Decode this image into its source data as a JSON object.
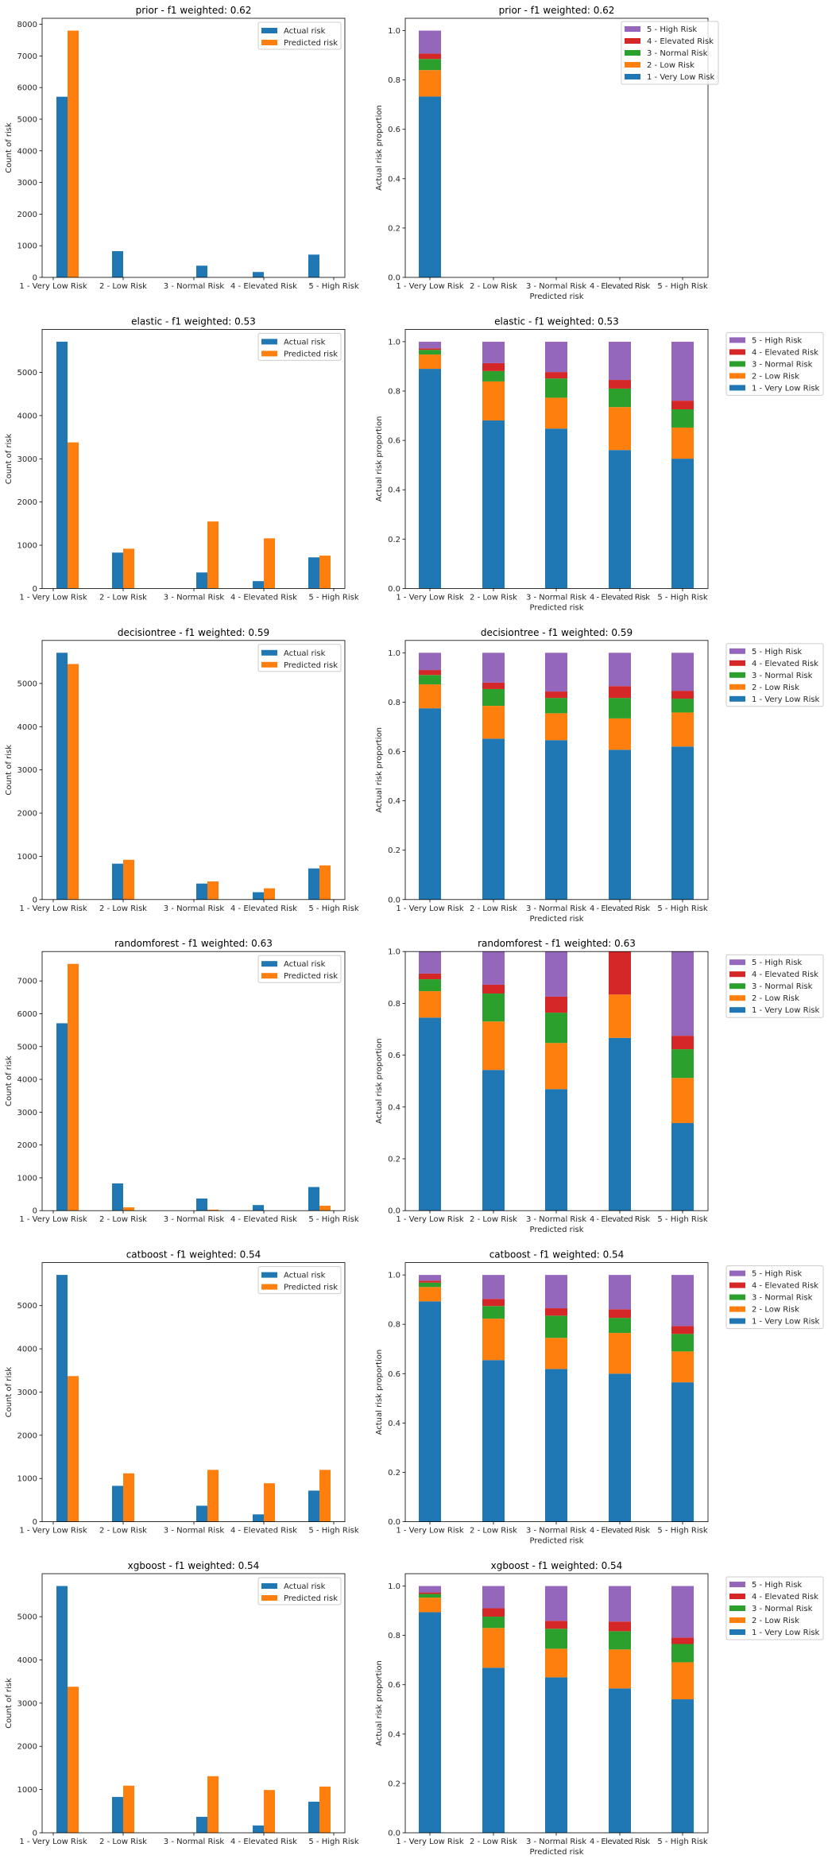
{
  "figure": {
    "categories": [
      "1 - Very Low Risk",
      "2 - Low Risk",
      "3 - Normal Risk",
      "4 - Elevated Risk",
      "5 - High Risk"
    ],
    "colors": {
      "actual": "#1f77b4",
      "predicted": "#ff7f0e",
      "risk": [
        "#1f77b4",
        "#ff7f0e",
        "#2ca02c",
        "#d62728",
        "#9467bd"
      ]
    },
    "count_chart_legend": [
      "Actual risk",
      "Predicted risk"
    ],
    "count_chart_ylabel": "Count of risk",
    "proportion_chart_ylabel": "Actual risk proportion",
    "proportion_chart_xlabel": "Predicted risk",
    "proportion_legend": [
      "5 - High Risk",
      "4 - Elevated Risk",
      "3 - Normal Risk",
      "2 - Low Risk",
      "1 - Very Low Risk"
    ]
  },
  "chart_data": [
    {
      "type": "bar",
      "model": "prior",
      "title": "prior - f1 weighted: 0.62",
      "categories": [
        "1 - Very Low Risk",
        "2 - Low Risk",
        "3 - Normal Risk",
        "4 - Elevated Risk",
        "5 - High Risk"
      ],
      "xlabel": "",
      "ylabel": "Count of risk",
      "ylim": [
        0,
        8190
      ],
      "yticks": [
        0,
        1000,
        2000,
        3000,
        4000,
        5000,
        6000,
        7000,
        8000
      ],
      "legend": "top-right",
      "series": [
        {
          "name": "Actual risk",
          "values": [
            5710,
            830,
            370,
            170,
            720
          ]
        },
        {
          "name": "Predicted risk",
          "values": [
            7800,
            0,
            0,
            0,
            0
          ]
        }
      ]
    },
    {
      "type": "bar",
      "stacked": true,
      "model": "prior",
      "title": "prior - f1 weighted: 0.62",
      "categories": [
        "1 - Very Low Risk",
        "2 - Low Risk",
        "3 - Normal Risk",
        "4 - Elevated Risk",
        "5 - High Risk"
      ],
      "xlabel": "Predicted risk",
      "ylabel": "Actual risk proportion",
      "ylim": [
        0,
        1.05
      ],
      "yticks": [
        0.0,
        0.2,
        0.4,
        0.6,
        0.8,
        1.0
      ],
      "legend": "top-right",
      "series": [
        {
          "name": "1 - Very Low Risk",
          "values": [
            0.733,
            0,
            0,
            0,
            0
          ]
        },
        {
          "name": "2 - Low Risk",
          "values": [
            0.107,
            0,
            0,
            0,
            0
          ]
        },
        {
          "name": "3 - Normal Risk",
          "values": [
            0.045,
            0,
            0,
            0,
            0
          ]
        },
        {
          "name": "4 - Elevated Risk",
          "values": [
            0.022,
            0,
            0,
            0,
            0
          ]
        },
        {
          "name": "5 - High Risk",
          "values": [
            0.093,
            0,
            0,
            0,
            0
          ]
        }
      ]
    },
    {
      "type": "bar",
      "model": "elastic",
      "title": "elastic - f1 weighted: 0.53",
      "categories": [
        "1 - Very Low Risk",
        "2 - Low Risk",
        "3 - Normal Risk",
        "4 - Elevated Risk",
        "5 - High Risk"
      ],
      "xlabel": "",
      "ylabel": "Count of risk",
      "ylim": [
        0,
        5995
      ],
      "yticks": [
        0,
        1000,
        2000,
        3000,
        4000,
        5000
      ],
      "legend": "top-right",
      "series": [
        {
          "name": "Actual risk",
          "values": [
            5710,
            830,
            370,
            170,
            720
          ]
        },
        {
          "name": "Predicted risk",
          "values": [
            3380,
            920,
            1550,
            1160,
            760
          ]
        }
      ]
    },
    {
      "type": "bar",
      "stacked": true,
      "model": "elastic",
      "title": "elastic - f1 weighted: 0.53",
      "categories": [
        "1 - Very Low Risk",
        "2 - Low Risk",
        "3 - Normal Risk",
        "4 - Elevated Risk",
        "5 - High Risk"
      ],
      "xlabel": "Predicted risk",
      "ylabel": "Actual risk proportion",
      "ylim": [
        0,
        1.05
      ],
      "yticks": [
        0.0,
        0.2,
        0.4,
        0.6,
        0.8,
        1.0
      ],
      "legend": "outside-right",
      "series": [
        {
          "name": "1 - Very Low Risk",
          "values": [
            0.89,
            0.681,
            0.648,
            0.561,
            0.526
          ]
        },
        {
          "name": "2 - Low Risk",
          "values": [
            0.058,
            0.158,
            0.125,
            0.174,
            0.126
          ]
        },
        {
          "name": "3 - Normal Risk",
          "values": [
            0.019,
            0.042,
            0.078,
            0.075,
            0.074
          ]
        },
        {
          "name": "4 - Elevated Risk",
          "values": [
            0.006,
            0.032,
            0.026,
            0.035,
            0.035
          ]
        },
        {
          "name": "5 - High Risk",
          "values": [
            0.027,
            0.087,
            0.123,
            0.155,
            0.239
          ]
        }
      ]
    },
    {
      "type": "bar",
      "model": "decisiontree",
      "title": "decisiontree - f1 weighted: 0.59",
      "categories": [
        "1 - Very Low Risk",
        "2 - Low Risk",
        "3 - Normal Risk",
        "4 - Elevated Risk",
        "5 - High Risk"
      ],
      "xlabel": "",
      "ylabel": "Count of risk",
      "ylim": [
        0,
        5995
      ],
      "yticks": [
        0,
        1000,
        2000,
        3000,
        4000,
        5000
      ],
      "legend": "top-right",
      "series": [
        {
          "name": "Actual risk",
          "values": [
            5710,
            830,
            370,
            170,
            720
          ]
        },
        {
          "name": "Predicted risk",
          "values": [
            5450,
            920,
            420,
            260,
            790
          ]
        }
      ]
    },
    {
      "type": "bar",
      "stacked": true,
      "model": "decisiontree",
      "title": "decisiontree - f1 weighted: 0.59",
      "categories": [
        "1 - Very Low Risk",
        "2 - Low Risk",
        "3 - Normal Risk",
        "4 - Elevated Risk",
        "5 - High Risk"
      ],
      "xlabel": "Predicted risk",
      "ylabel": "Actual risk proportion",
      "ylim": [
        0,
        1.05
      ],
      "yticks": [
        0.0,
        0.2,
        0.4,
        0.6,
        0.8,
        1.0
      ],
      "legend": "outside-right",
      "series": [
        {
          "name": "1 - Very Low Risk",
          "values": [
            0.775,
            0.652,
            0.646,
            0.607,
            0.62
          ]
        },
        {
          "name": "2 - Low Risk",
          "values": [
            0.097,
            0.133,
            0.109,
            0.127,
            0.138
          ]
        },
        {
          "name": "3 - Normal Risk",
          "values": [
            0.038,
            0.068,
            0.062,
            0.083,
            0.056
          ]
        },
        {
          "name": "4 - Elevated Risk",
          "values": [
            0.02,
            0.026,
            0.026,
            0.048,
            0.032
          ]
        },
        {
          "name": "5 - High Risk",
          "values": [
            0.07,
            0.121,
            0.157,
            0.135,
            0.154
          ]
        }
      ]
    },
    {
      "type": "bar",
      "model": "randomforest",
      "title": "randomforest - f1 weighted: 0.63",
      "categories": [
        "1 - Very Low Risk",
        "2 - Low Risk",
        "3 - Normal Risk",
        "4 - Elevated Risk",
        "5 - High Risk"
      ],
      "xlabel": "",
      "ylabel": "Count of risk",
      "ylim": [
        0,
        7896
      ],
      "yticks": [
        0,
        1000,
        2000,
        3000,
        4000,
        5000,
        6000,
        7000
      ],
      "legend": "top-right",
      "series": [
        {
          "name": "Actual risk",
          "values": [
            5710,
            830,
            370,
            170,
            720
          ]
        },
        {
          "name": "Predicted risk",
          "values": [
            7520,
            100,
            30,
            3,
            150
          ]
        }
      ]
    },
    {
      "type": "bar",
      "stacked": true,
      "model": "randomforest",
      "title": "randomforest - f1 weighted: 0.63",
      "categories": [
        "1 - Very Low Risk",
        "2 - Low Risk",
        "3 - Normal Risk",
        "4 - Elevated Risk",
        "5 - High Risk"
      ],
      "xlabel": "Predicted risk",
      "ylabel": "Actual risk proportion",
      "ylim": [
        0,
        1.0
      ],
      "yticks": [
        0.0,
        0.2,
        0.4,
        0.6,
        0.8,
        1.0
      ],
      "legend": "outside-right",
      "series": [
        {
          "name": "1 - Very Low Risk",
          "values": [
            0.745,
            0.543,
            0.469,
            0.667,
            0.338
          ]
        },
        {
          "name": "2 - Low Risk",
          "values": [
            0.102,
            0.187,
            0.178,
            0.167,
            0.174
          ]
        },
        {
          "name": "3 - Normal Risk",
          "values": [
            0.046,
            0.108,
            0.117,
            0.0,
            0.111
          ]
        },
        {
          "name": "4 - Elevated Risk",
          "values": [
            0.022,
            0.034,
            0.062,
            0.166,
            0.052
          ]
        },
        {
          "name": "5 - High Risk",
          "values": [
            0.085,
            0.128,
            0.174,
            0.0,
            0.325
          ]
        }
      ]
    },
    {
      "type": "bar",
      "model": "catboost",
      "title": "catboost - f1 weighted: 0.54",
      "categories": [
        "1 - Very Low Risk",
        "2 - Low Risk",
        "3 - Normal Risk",
        "4 - Elevated Risk",
        "5 - High Risk"
      ],
      "xlabel": "",
      "ylabel": "Count of risk",
      "ylim": [
        0,
        5995
      ],
      "yticks": [
        0,
        1000,
        2000,
        3000,
        4000,
        5000
      ],
      "legend": "top-right",
      "series": [
        {
          "name": "Actual risk",
          "values": [
            5710,
            830,
            370,
            170,
            720
          ]
        },
        {
          "name": "Predicted risk",
          "values": [
            3370,
            1120,
            1200,
            890,
            1200
          ]
        }
      ]
    },
    {
      "type": "bar",
      "stacked": true,
      "model": "catboost",
      "title": "catboost - f1 weighted: 0.54",
      "categories": [
        "1 - Very Low Risk",
        "2 - Low Risk",
        "3 - Normal Risk",
        "4 - Elevated Risk",
        "5 - High Risk"
      ],
      "xlabel": "Predicted risk",
      "ylabel": "Actual risk proportion",
      "ylim": [
        0,
        1.05
      ],
      "yticks": [
        0.0,
        0.2,
        0.4,
        0.6,
        0.8,
        1.0
      ],
      "legend": "outside-right",
      "series": [
        {
          "name": "1 - Very Low Risk",
          "values": [
            0.893,
            0.655,
            0.619,
            0.6,
            0.565
          ]
        },
        {
          "name": "2 - Low Risk",
          "values": [
            0.058,
            0.168,
            0.126,
            0.165,
            0.125
          ]
        },
        {
          "name": "3 - Normal Risk",
          "values": [
            0.018,
            0.051,
            0.09,
            0.061,
            0.071
          ]
        },
        {
          "name": "4 - Elevated Risk",
          "values": [
            0.008,
            0.029,
            0.03,
            0.035,
            0.032
          ]
        },
        {
          "name": "5 - High Risk",
          "values": [
            0.023,
            0.097,
            0.135,
            0.139,
            0.207
          ]
        }
      ]
    },
    {
      "type": "bar",
      "model": "xgboost",
      "title": "xgboost - f1 weighted: 0.54",
      "categories": [
        "1 - Very Low Risk",
        "2 - Low Risk",
        "3 - Normal Risk",
        "4 - Elevated Risk",
        "5 - High Risk"
      ],
      "xlabel": "",
      "ylabel": "Count of risk",
      "ylim": [
        0,
        5995
      ],
      "yticks": [
        0,
        1000,
        2000,
        3000,
        4000,
        5000
      ],
      "legend": "top-right",
      "series": [
        {
          "name": "Actual risk",
          "values": [
            5710,
            830,
            370,
            170,
            720
          ]
        },
        {
          "name": "Predicted risk",
          "values": [
            3380,
            1090,
            1310,
            990,
            1070
          ]
        }
      ]
    },
    {
      "type": "bar",
      "stacked": true,
      "model": "xgboost",
      "title": "xgboost - f1 weighted: 0.54",
      "categories": [
        "1 - Very Low Risk",
        "2 - Low Risk",
        "3 - Normal Risk",
        "4 - Elevated Risk",
        "5 - High Risk"
      ],
      "xlabel": "Predicted risk",
      "ylabel": "Actual risk proportion",
      "ylim": [
        0,
        1.05
      ],
      "yticks": [
        0.0,
        0.2,
        0.4,
        0.6,
        0.8,
        1.0
      ],
      "legend": "outside-right",
      "series": [
        {
          "name": "1 - Very Low Risk",
          "values": [
            0.894,
            0.669,
            0.63,
            0.585,
            0.541
          ]
        },
        {
          "name": "2 - Low Risk",
          "values": [
            0.059,
            0.161,
            0.116,
            0.158,
            0.15
          ]
        },
        {
          "name": "3 - Normal Risk",
          "values": [
            0.015,
            0.046,
            0.081,
            0.074,
            0.074
          ]
        },
        {
          "name": "4 - Elevated Risk",
          "values": [
            0.006,
            0.034,
            0.032,
            0.039,
            0.026
          ]
        },
        {
          "name": "5 - High Risk",
          "values": [
            0.026,
            0.09,
            0.141,
            0.144,
            0.209
          ]
        }
      ]
    }
  ]
}
